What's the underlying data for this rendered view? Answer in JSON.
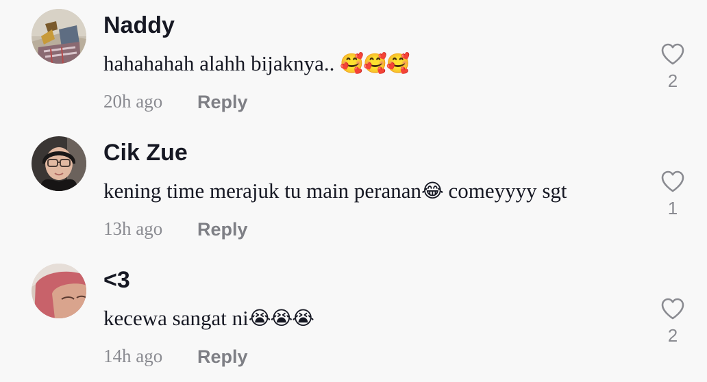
{
  "comments": [
    {
      "username": "Naddy",
      "text": "hahahahah alahh bijaknya.. ",
      "emojis": "🥰🥰🥰",
      "time": "20h ago",
      "reply_label": "Reply",
      "like_count": "2"
    },
    {
      "username": "Cik Zue",
      "text_before": "kening time merajuk tu main peranan",
      "emoji": "😂",
      "text_after": " comeyyyy sgt",
      "time": "13h ago",
      "reply_label": "Reply",
      "like_count": "1"
    },
    {
      "username": "<3",
      "text": "kecewa sangat ni",
      "emojis": "😭😭😭",
      "time": "14h ago",
      "reply_label": "Reply",
      "like_count": "2"
    }
  ],
  "colors": {
    "background": "#f8f8f8",
    "username": "#161823",
    "muted": "#8a8b91"
  },
  "icons": {
    "like": "heart-outline-icon"
  }
}
